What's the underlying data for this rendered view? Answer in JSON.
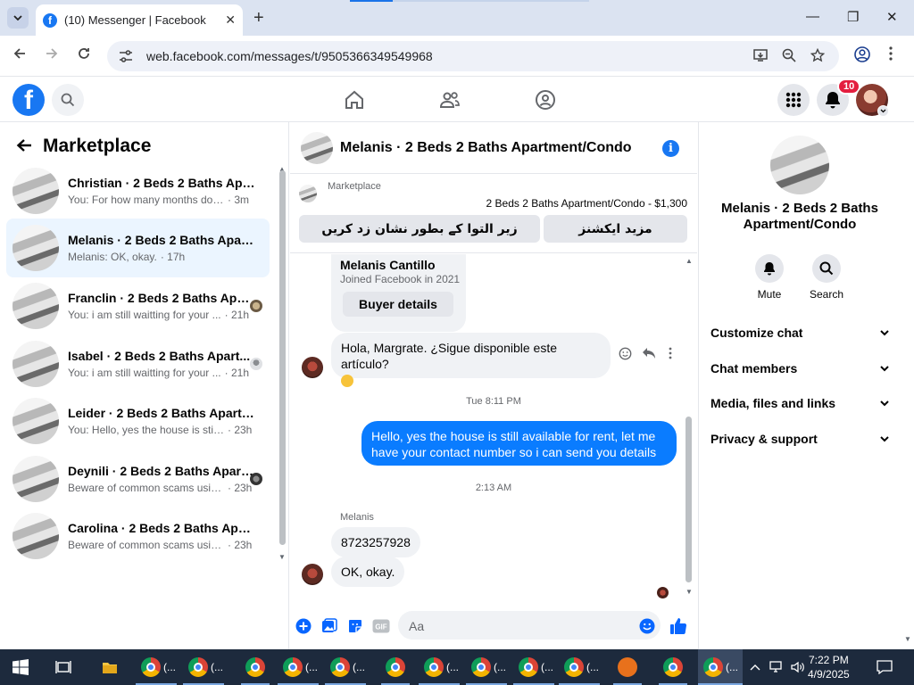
{
  "browser": {
    "tab_title": "(10) Messenger | Facebook",
    "url": "web.facebook.com/messages/t/9505366349549968"
  },
  "header": {
    "notification_count": "10"
  },
  "left": {
    "title": "Marketplace",
    "conversations": [
      {
        "name": "Christian · 2 Beds 2 Baths Apart...",
        "preview": "You: For how many months do yo...",
        "time": "· 3m"
      },
      {
        "name": "Melanis · 2 Beds 2 Baths Apartm...",
        "preview": "Melanis: OK, okay.",
        "time": "· 17h"
      },
      {
        "name": "Franclin · 2 Beds 2 Baths Apar...",
        "preview": "You: i am still waitting for your ...",
        "time": "· 21h"
      },
      {
        "name": "Isabel · 2 Beds 2 Baths Apart...",
        "preview": "You: i am still waitting for your ...",
        "time": "· 21h"
      },
      {
        "name": "Leider · 2 Beds 2 Baths Apartme...",
        "preview": "You: Hello, yes the house is still av...",
        "time": "· 23h"
      },
      {
        "name": "Deynili · 2 Beds 2 Baths Apart...",
        "preview": "Beware of common scams usin...",
        "time": "· 23h"
      },
      {
        "name": "Carolina · 2 Beds 2 Baths Apart...",
        "preview": "Beware of common scams using ...",
        "time": "· 23h"
      }
    ]
  },
  "chat": {
    "title": "Melanis · 2 Beds 2 Baths Apartment/Condo",
    "marketplace_label": "Marketplace",
    "listing": "2 Beds 2 Baths Apartment/Condo - $1,300",
    "mark_pending_button": "زیر التوا کے بطور نشان زد کریں",
    "more_actions_button": "مزید ایکشنز",
    "buyer_card": {
      "name": "Melanis Cantillo",
      "joined": "Joined Facebook in 2021",
      "button": "Buyer details"
    },
    "messages": [
      {
        "from": "them",
        "text": "Hola, Margrate. ¿Sigue disponible este artículo?"
      },
      {
        "type": "timestamp",
        "text": "Tue 8:11 PM"
      },
      {
        "from": "me",
        "text": "Hello, yes the house is still available for rent, let me have your contact number so i can send you  details"
      },
      {
        "type": "timestamp",
        "text": "2:13 AM"
      },
      {
        "type": "sender",
        "text": "Melanis"
      },
      {
        "from": "them",
        "text": "8723257928"
      },
      {
        "from": "them",
        "text": "OK, okay."
      }
    ],
    "composer_placeholder": "Aa"
  },
  "right": {
    "name": "Melanis · 2 Beds 2 Baths Apartment/Condo",
    "actions": [
      {
        "label": "Mute"
      },
      {
        "label": "Search"
      }
    ],
    "sections": [
      "Customize chat",
      "Chat members",
      "Media, files and links",
      "Privacy & support"
    ]
  },
  "taskbar": {
    "chrome_label": "(...",
    "time": "7:22 PM",
    "date": "4/9/2025"
  },
  "colors": {
    "brand": "#1877f2",
    "outgoing": "#0a7cff",
    "badge": "#e41e3f",
    "active_row": "#ebf5ff"
  }
}
